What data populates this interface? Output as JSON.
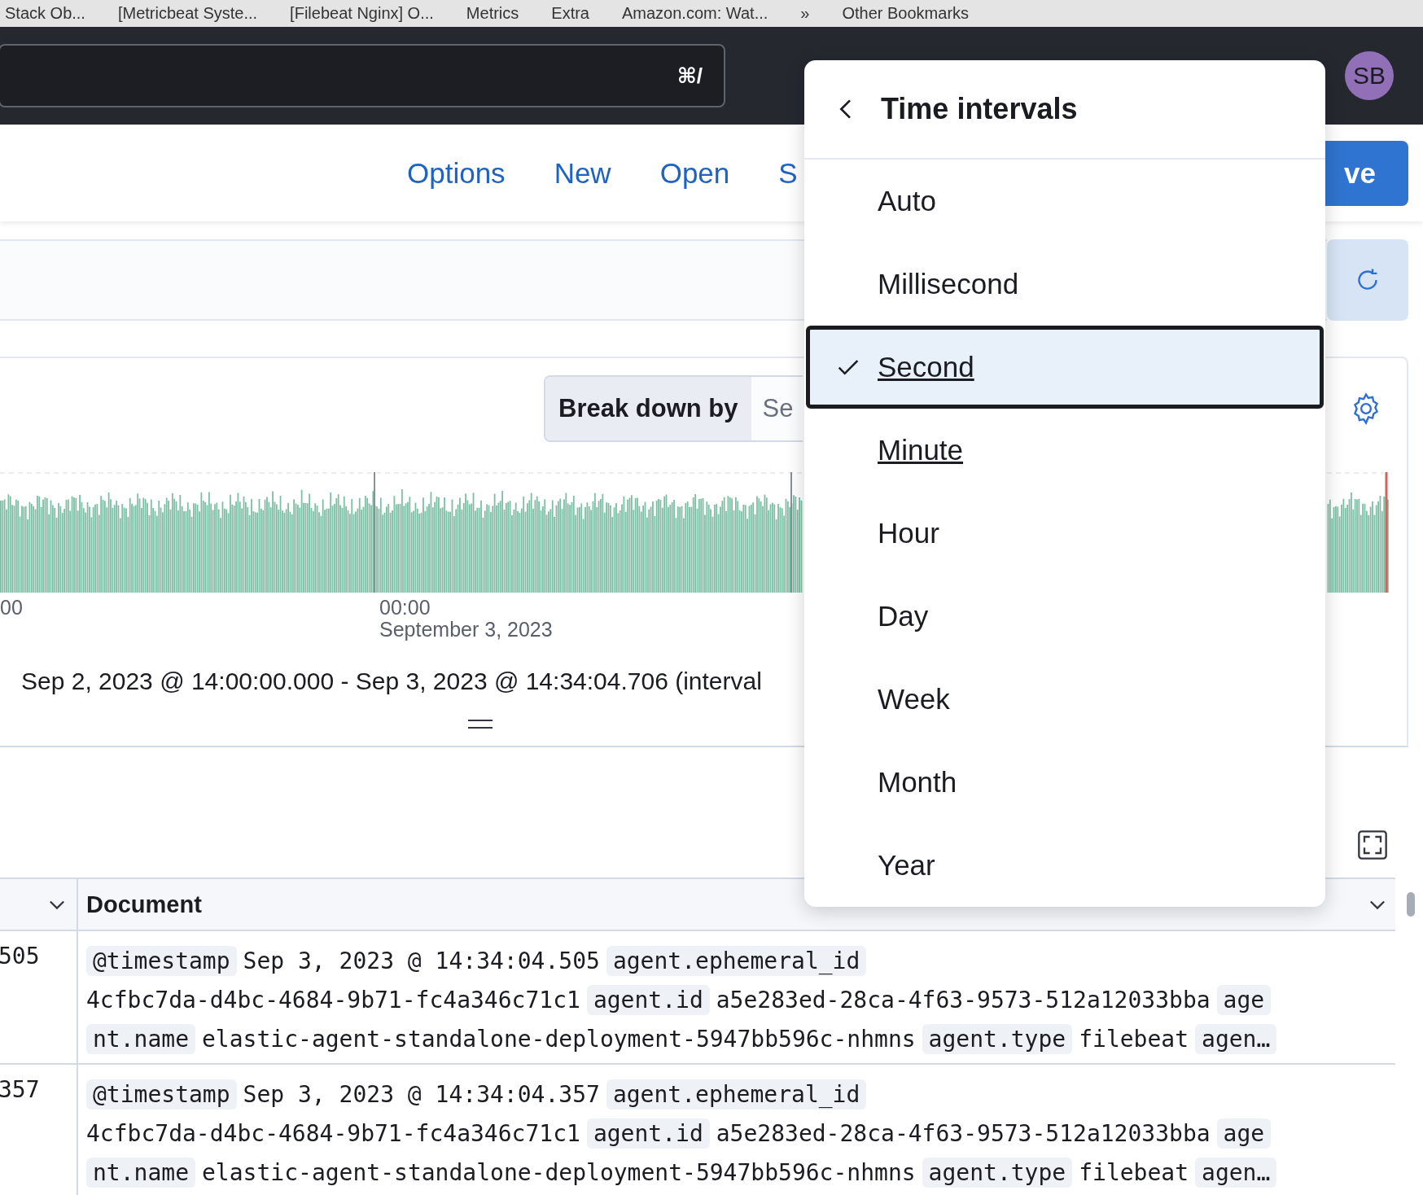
{
  "bookmarks": [
    {
      "label": "Stack Ob..."
    },
    {
      "label": "[Metricbeat Syste..."
    },
    {
      "label": "[Filebeat Nginx] O..."
    },
    {
      "label": "Metrics"
    },
    {
      "label": "Extra"
    },
    {
      "label": "Amazon.com: Wat..."
    },
    {
      "label": "»"
    },
    {
      "label": "Other Bookmarks"
    }
  ],
  "search": {
    "shortcut": "⌘/"
  },
  "avatar": {
    "initials": "SB"
  },
  "nav": {
    "links": [
      "Options",
      "New",
      "Open",
      "S"
    ],
    "save": "ve"
  },
  "chart": {
    "breakdown_label": "Break down by",
    "breakdown_value": "Se",
    "ticks": [
      {
        "time": "00"
      },
      {
        "time": "00:00",
        "date": "September 3, 2023"
      }
    ]
  },
  "time_range": "Sep 2, 2023 @ 14:00:00.000 - Sep 3, 2023 @ 14:34:04.706 (interval",
  "table": {
    "header": "Document",
    "rows": [
      {
        "time": "505",
        "lines": [
          [
            {
              "kind": "key",
              "text": "@timestamp"
            },
            {
              "kind": "value",
              "text": "Sep 3, 2023 @ 14:34:04.505"
            },
            {
              "kind": "key",
              "text": "agent.ephemeral_id"
            }
          ],
          [
            {
              "kind": "value",
              "text": "4cfbc7da-d4bc-4684-9b71-fc4a346c71c1"
            },
            {
              "kind": "key",
              "text": "agent.id"
            },
            {
              "kind": "value",
              "text": "a5e283ed-28ca-4f63-9573-512a12033bba"
            },
            {
              "kind": "key",
              "text": "age"
            }
          ],
          [
            {
              "kind": "key",
              "text": "nt.name"
            },
            {
              "kind": "value",
              "text": "elastic-agent-standalone-deployment-5947bb596c-nhmns"
            },
            {
              "kind": "key",
              "text": "agent.type"
            },
            {
              "kind": "value",
              "text": "filebeat"
            },
            {
              "kind": "key",
              "text": "agen…"
            }
          ]
        ]
      },
      {
        "time": "357",
        "lines": [
          [
            {
              "kind": "key",
              "text": "@timestamp"
            },
            {
              "kind": "value",
              "text": "Sep 3, 2023 @ 14:34:04.357"
            },
            {
              "kind": "key",
              "text": "agent.ephemeral_id"
            }
          ],
          [
            {
              "kind": "value",
              "text": "4cfbc7da-d4bc-4684-9b71-fc4a346c71c1"
            },
            {
              "kind": "key",
              "text": "agent.id"
            },
            {
              "kind": "value",
              "text": "a5e283ed-28ca-4f63-9573-512a12033bba"
            },
            {
              "kind": "key",
              "text": "age"
            }
          ],
          [
            {
              "kind": "key",
              "text": "nt.name"
            },
            {
              "kind": "value",
              "text": "elastic-agent-standalone-deployment-5947bb596c-nhmns"
            },
            {
              "kind": "key",
              "text": "agent.type"
            },
            {
              "kind": "value",
              "text": "filebeat"
            },
            {
              "kind": "key",
              "text": "agen…"
            }
          ]
        ]
      }
    ]
  },
  "menu": {
    "title": "Time intervals",
    "items": [
      {
        "label": "Auto",
        "selected": false,
        "hovered": false
      },
      {
        "label": "Millisecond",
        "selected": false,
        "hovered": false
      },
      {
        "label": "Second",
        "selected": true,
        "hovered": false
      },
      {
        "label": "Minute",
        "selected": false,
        "hovered": true
      },
      {
        "label": "Hour",
        "selected": false,
        "hovered": false
      },
      {
        "label": "Day",
        "selected": false,
        "hovered": false
      },
      {
        "label": "Week",
        "selected": false,
        "hovered": false
      },
      {
        "label": "Month",
        "selected": false,
        "hovered": false
      },
      {
        "label": "Year",
        "selected": false,
        "hovered": false
      }
    ]
  }
}
